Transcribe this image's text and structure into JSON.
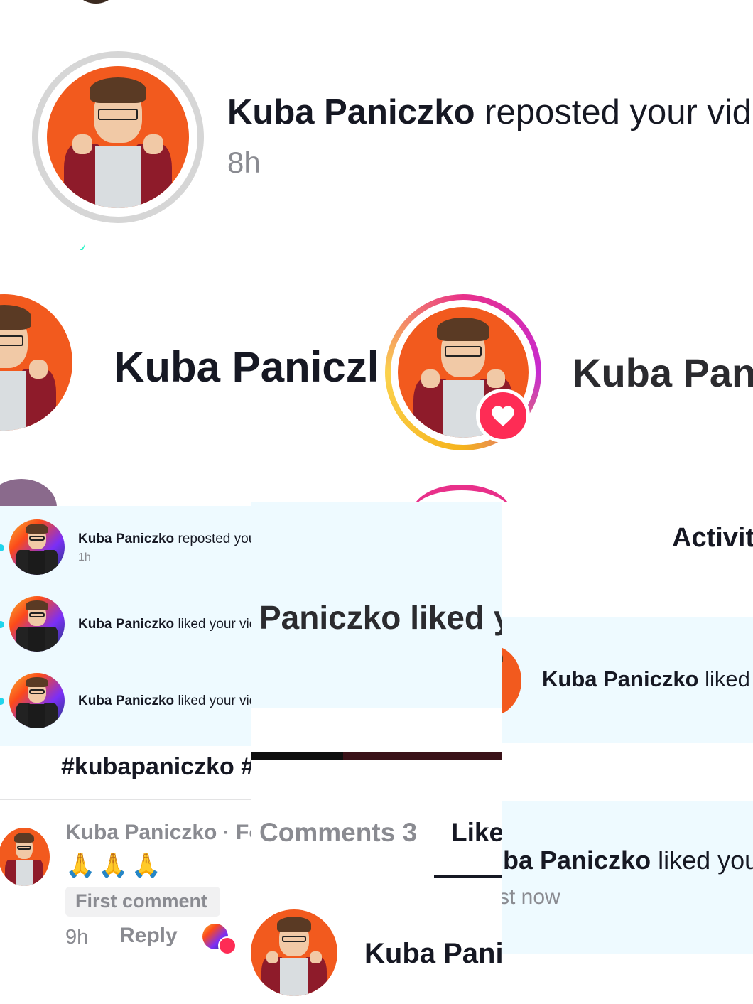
{
  "top_notification": {
    "name": "Kuba Paniczko",
    "action": "reposted your vid",
    "time": "8h"
  },
  "mid_left": {
    "name": "Kuba Paniczk"
  },
  "mid_right": {
    "name": "Kuba Pan",
    "badge_icon": "heart-icon"
  },
  "activity_list": [
    {
      "name": "Kuba Paniczko",
      "action": "reposted your",
      "time": "1h"
    },
    {
      "name": "Kuba Paniczko",
      "action": "liked your vide"
    },
    {
      "name": "Kuba Paniczko",
      "action": "liked your vide"
    }
  ],
  "activity_list_partial_time": "",
  "large_liked": {
    "text": "Paniczko liked yo"
  },
  "activity_header": {
    "title": "Activit"
  },
  "right_liked_1": {
    "name": "Kuba Paniczko",
    "action": "liked y"
  },
  "right_liked_2": {
    "name": "ba Paniczko",
    "action": "liked you",
    "time": "st now"
  },
  "hashtags": {
    "text": "#kubapaniczko #"
  },
  "comment": {
    "author": "Kuba Paniczko · Fo",
    "emoji": "🙏🙏🙏",
    "pinned_label": "First comment",
    "time": "9h",
    "reply_label": "Reply"
  },
  "tabs": {
    "comments_label": "Comments 3",
    "likes_label": "Like"
  },
  "bottom_user": {
    "name": "Kuba Pani"
  },
  "colors": {
    "accent": "#fe2c55",
    "highlight_bg": "#eefaff",
    "muted": "#8a8b91"
  }
}
